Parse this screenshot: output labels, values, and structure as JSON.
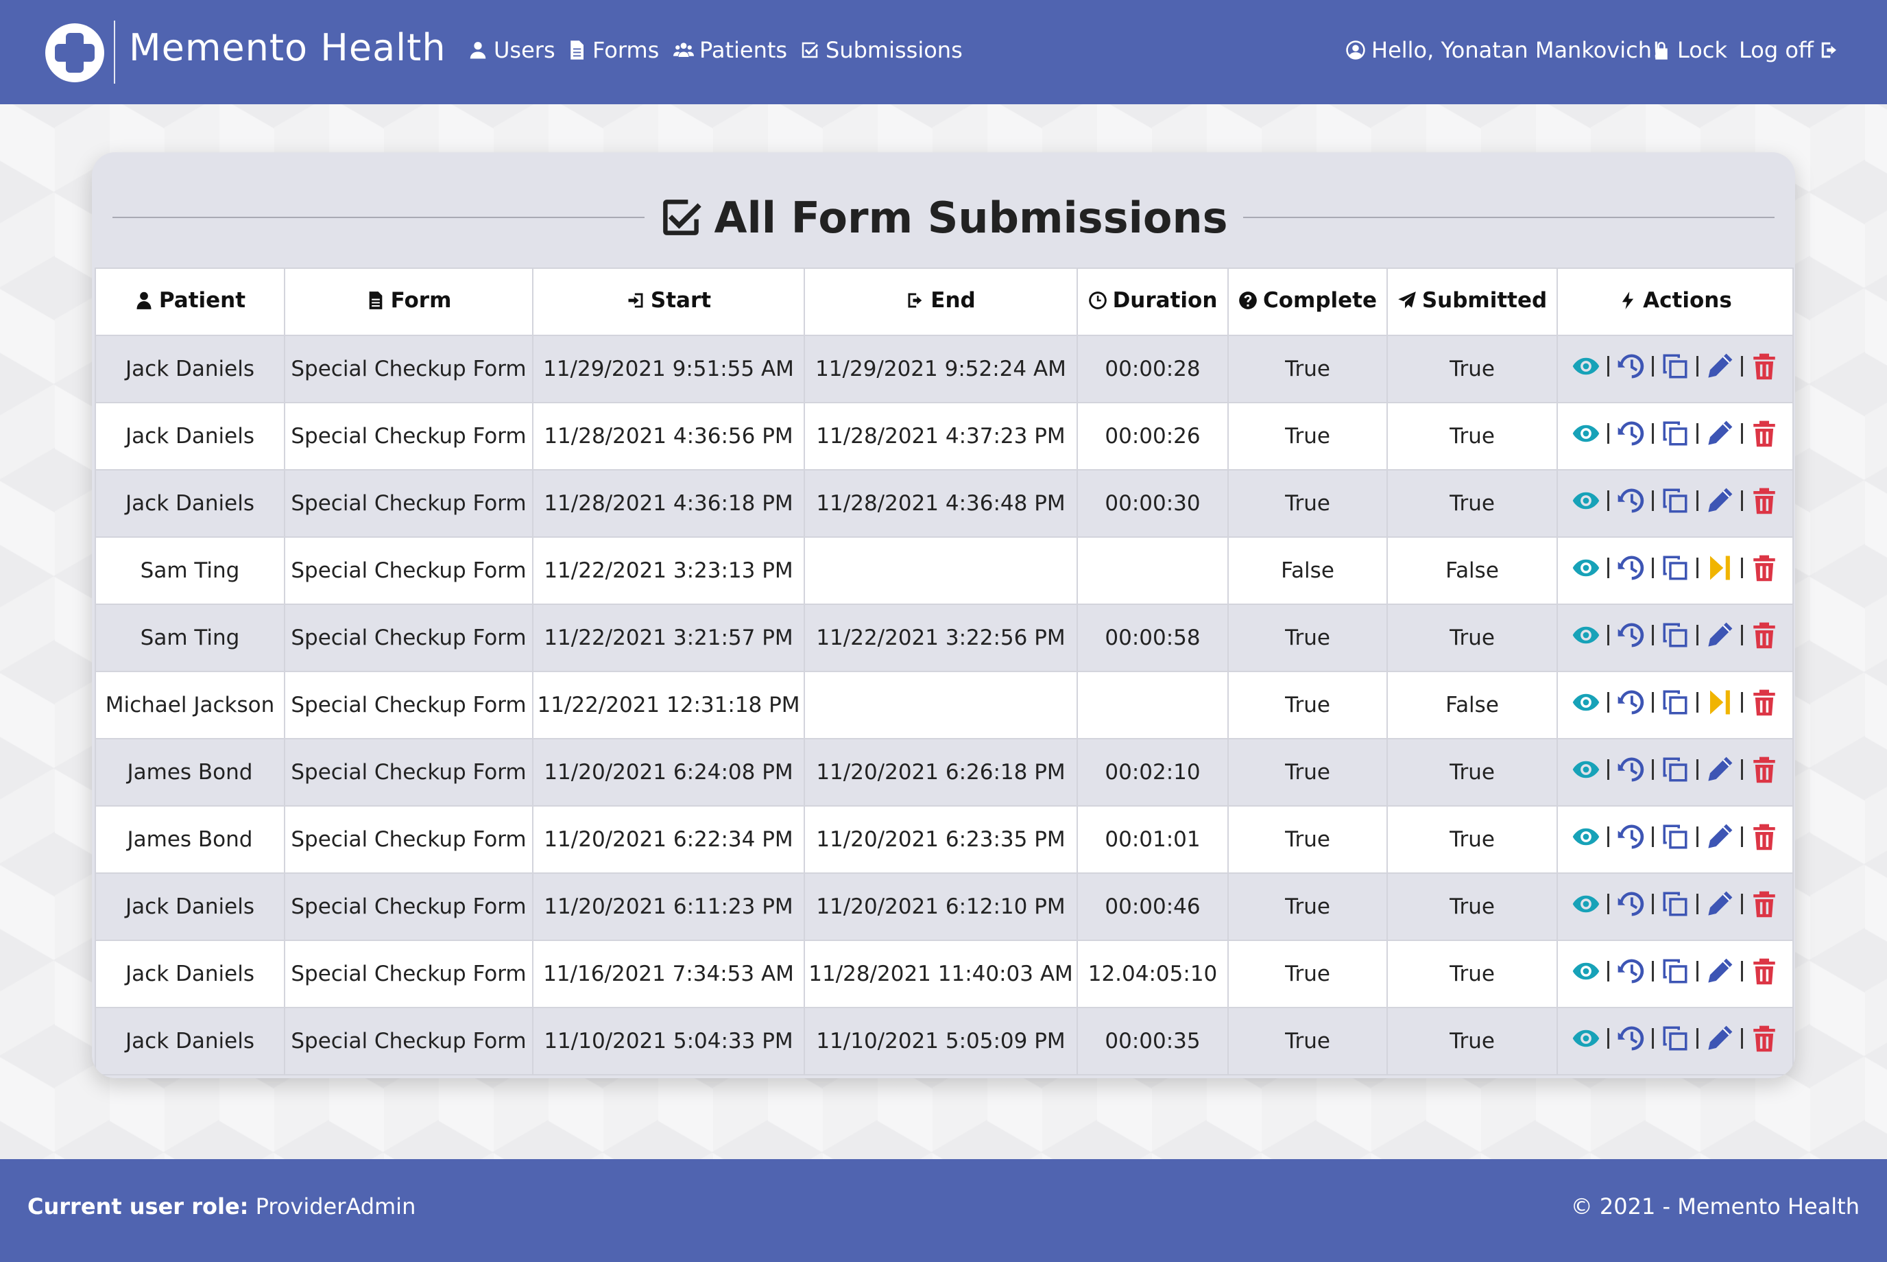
{
  "brand": {
    "name": "Memento Health"
  },
  "nav": {
    "users": "Users",
    "forms": "Forms",
    "patients": "Patients",
    "submissions": "Submissions",
    "greeting": "Hello, Yonatan Mankovich!",
    "lock": "Lock",
    "logoff": "Log off"
  },
  "page": {
    "title": "All Form Submissions"
  },
  "table": {
    "headers": {
      "patient": "Patient",
      "form": "Form",
      "start": "Start",
      "end": "End",
      "duration": "Duration",
      "complete": "Complete",
      "submitted": "Submitted",
      "actions": "Actions"
    },
    "rows": [
      {
        "patient": "Jack Daniels",
        "form": "Special Checkup Form",
        "start": "11/29/2021 9:51:55 AM",
        "end": "11/29/2021 9:52:24 AM",
        "duration": "00:00:28",
        "complete": "True",
        "submitted": "True",
        "action": "edit"
      },
      {
        "patient": "Jack Daniels",
        "form": "Special Checkup Form",
        "start": "11/28/2021 4:36:56 PM",
        "end": "11/28/2021 4:37:23 PM",
        "duration": "00:00:26",
        "complete": "True",
        "submitted": "True",
        "action": "edit"
      },
      {
        "patient": "Jack Daniels",
        "form": "Special Checkup Form",
        "start": "11/28/2021 4:36:18 PM",
        "end": "11/28/2021 4:36:48 PM",
        "duration": "00:00:30",
        "complete": "True",
        "submitted": "True",
        "action": "edit"
      },
      {
        "patient": "Sam Ting",
        "form": "Special Checkup Form",
        "start": "11/22/2021 3:23:13 PM",
        "end": "",
        "duration": "",
        "complete": "False",
        "submitted": "False",
        "action": "resume"
      },
      {
        "patient": "Sam Ting",
        "form": "Special Checkup Form",
        "start": "11/22/2021 3:21:57 PM",
        "end": "11/22/2021 3:22:56 PM",
        "duration": "00:00:58",
        "complete": "True",
        "submitted": "True",
        "action": "edit"
      },
      {
        "patient": "Michael Jackson",
        "form": "Special Checkup Form",
        "start": "11/22/2021 12:31:18 PM",
        "end": "",
        "duration": "",
        "complete": "True",
        "submitted": "False",
        "action": "resume"
      },
      {
        "patient": "James Bond",
        "form": "Special Checkup Form",
        "start": "11/20/2021 6:24:08 PM",
        "end": "11/20/2021 6:26:18 PM",
        "duration": "00:02:10",
        "complete": "True",
        "submitted": "True",
        "action": "edit"
      },
      {
        "patient": "James Bond",
        "form": "Special Checkup Form",
        "start": "11/20/2021 6:22:34 PM",
        "end": "11/20/2021 6:23:35 PM",
        "duration": "00:01:01",
        "complete": "True",
        "submitted": "True",
        "action": "edit"
      },
      {
        "patient": "Jack Daniels",
        "form": "Special Checkup Form",
        "start": "11/20/2021 6:11:23 PM",
        "end": "11/20/2021 6:12:10 PM",
        "duration": "00:00:46",
        "complete": "True",
        "submitted": "True",
        "action": "edit"
      },
      {
        "patient": "Jack Daniels",
        "form": "Special Checkup Form",
        "start": "11/16/2021 7:34:53 AM",
        "end": "11/28/2021 11:40:03 AM",
        "duration": "12.04:05:10",
        "complete": "True",
        "submitted": "True",
        "action": "edit"
      },
      {
        "patient": "Jack Daniels",
        "form": "Special Checkup Form",
        "start": "11/10/2021 5:04:33 PM",
        "end": "11/10/2021 5:05:09 PM",
        "duration": "00:00:35",
        "complete": "True",
        "submitted": "True",
        "action": "edit"
      }
    ]
  },
  "icons": {
    "view": "eye-icon",
    "history": "history-icon",
    "copy": "copy-icon",
    "edit": "pencil-icon",
    "resume": "step-forward-icon",
    "delete": "trash-icon"
  },
  "colors": {
    "brand": "#5064b0",
    "view": "#17a2b8",
    "action_blue": "#3d55b4",
    "resume": "#f0b400",
    "delete": "#dc3545"
  },
  "footer": {
    "role_label": "Current user role:",
    "role_value": "ProviderAdmin",
    "copyright": "© 2021 - Memento Health"
  }
}
